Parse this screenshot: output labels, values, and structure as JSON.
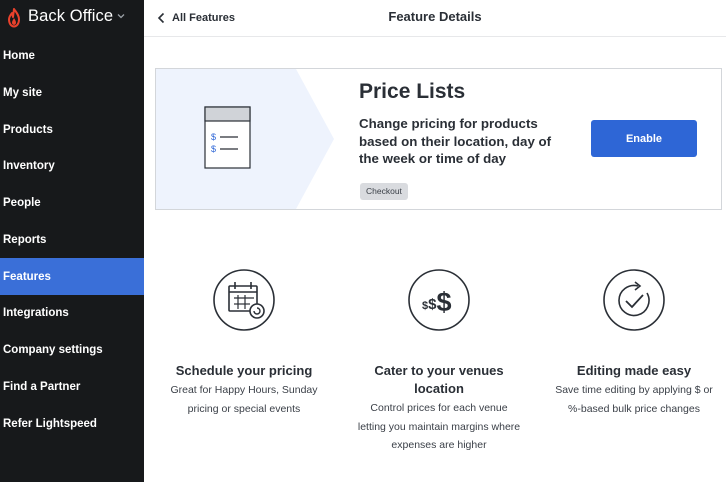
{
  "app": {
    "title": "Back Office"
  },
  "sidebar": {
    "items": [
      {
        "label": "Home"
      },
      {
        "label": "My site"
      },
      {
        "label": "Products"
      },
      {
        "label": "Inventory"
      },
      {
        "label": "People"
      },
      {
        "label": "Reports"
      },
      {
        "label": "Features",
        "active": true
      },
      {
        "label": "Integrations"
      },
      {
        "label": "Company settings"
      },
      {
        "label": "Find a Partner"
      },
      {
        "label": "Refer Lightspeed"
      }
    ]
  },
  "header": {
    "back_label": "All Features",
    "title": "Feature Details"
  },
  "feature": {
    "title": "Price Lists",
    "description": "Change pricing for products based on their location, day of the week or time of day",
    "tag": "Checkout",
    "enable_label": "Enable",
    "icon_text": "$"
  },
  "benefits": [
    {
      "icon": "calendar-icon",
      "title": "Schedule your pricing",
      "description": "Great for Happy Hours, Sunday pricing or special events"
    },
    {
      "icon": "dollar-signs-icon",
      "icon_text": "$$$",
      "title": "Cater to your venues location",
      "description": "Control prices for each venue letting you maintain margins where expenses are higher"
    },
    {
      "icon": "circular-check-icon",
      "title": "Editing made easy",
      "description": "Save time editing by applying $ or %-based bulk price changes"
    }
  ],
  "colors": {
    "sidebar_bg": "#17191b",
    "active_nav": "#3a6fd8",
    "brand_logo": "#e8412c",
    "primary_button": "#2e66d6",
    "card_art_bg": "#eef3fd"
  }
}
